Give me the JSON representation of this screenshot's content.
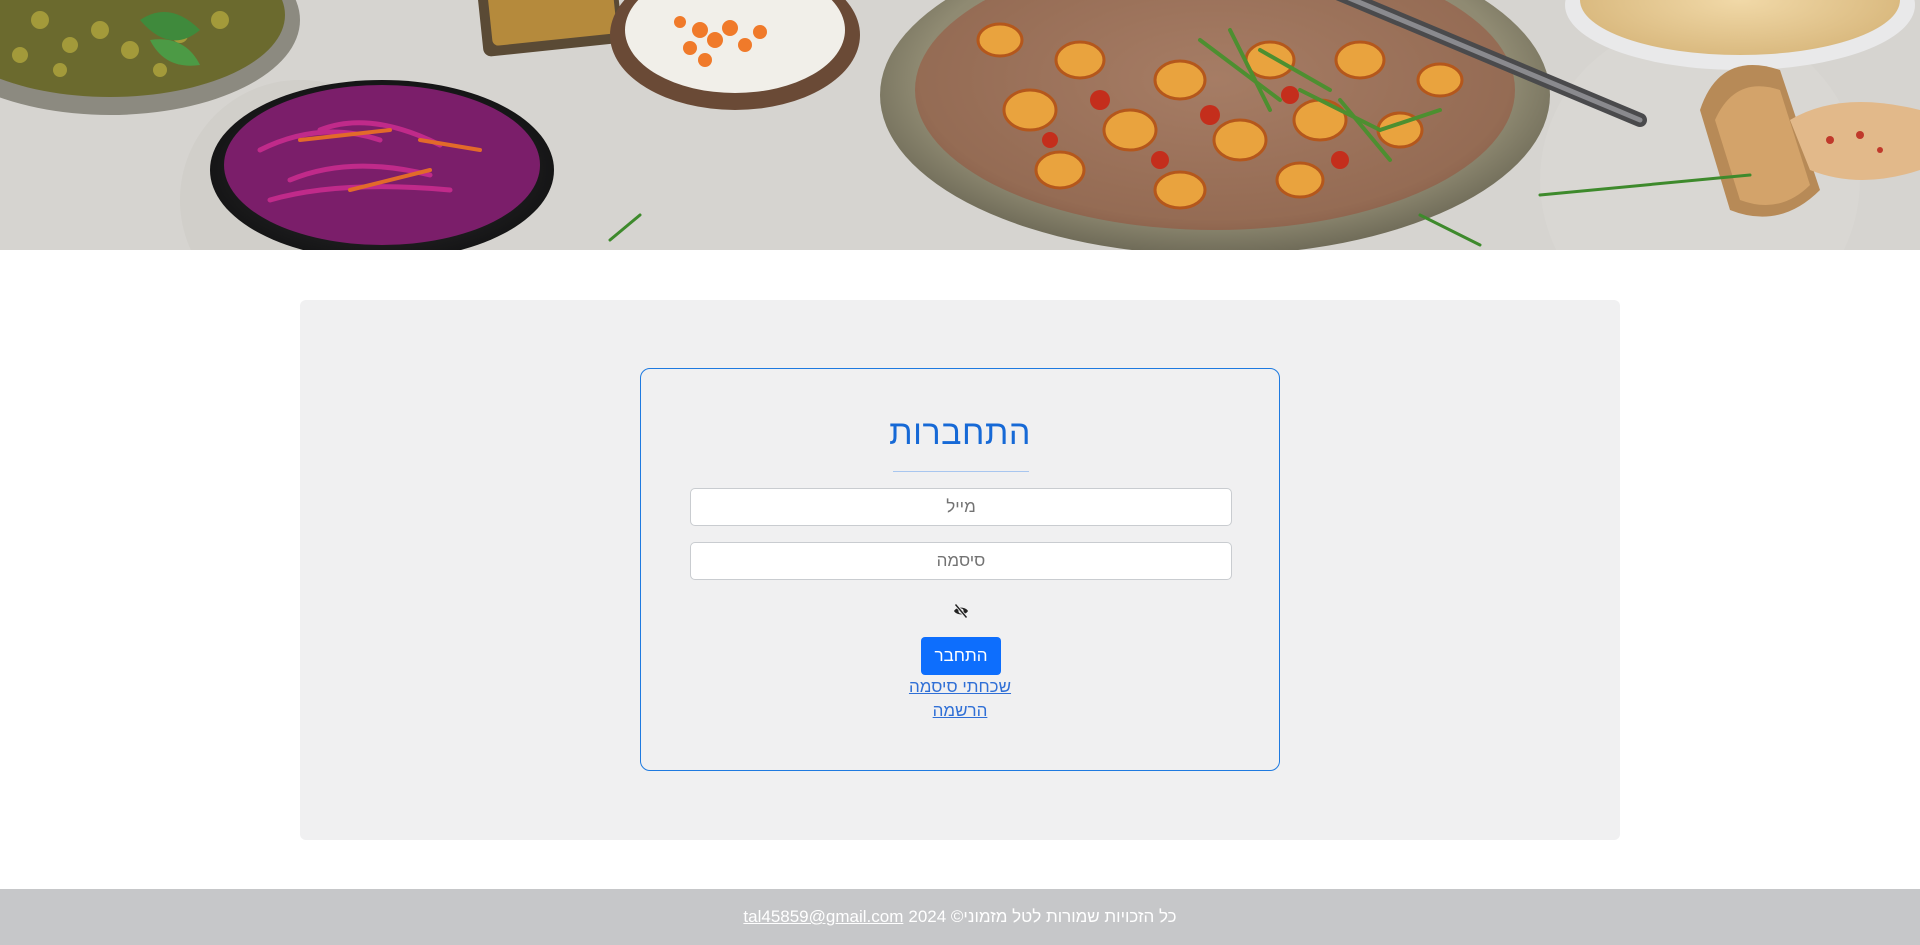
{
  "login": {
    "title": "התחברות",
    "email_placeholder": "מייל",
    "password_placeholder": "סיסמה",
    "toggle_icon": "eye-slash-icon",
    "submit_label": "התחבר",
    "forgot_password_link": "שכחתי סיסמה",
    "register_link": "הרשמה"
  },
  "footer": {
    "copyright_text": "כל הזכויות שמורות לטל מזמוני© 2024",
    "email": "tal45859@gmail.com"
  },
  "colors": {
    "primary": "#0d6efd",
    "title": "#1669d6",
    "card_border": "#1e7ae0",
    "panel_bg": "#f0f0f1",
    "footer_bg": "#c6c7c9"
  }
}
